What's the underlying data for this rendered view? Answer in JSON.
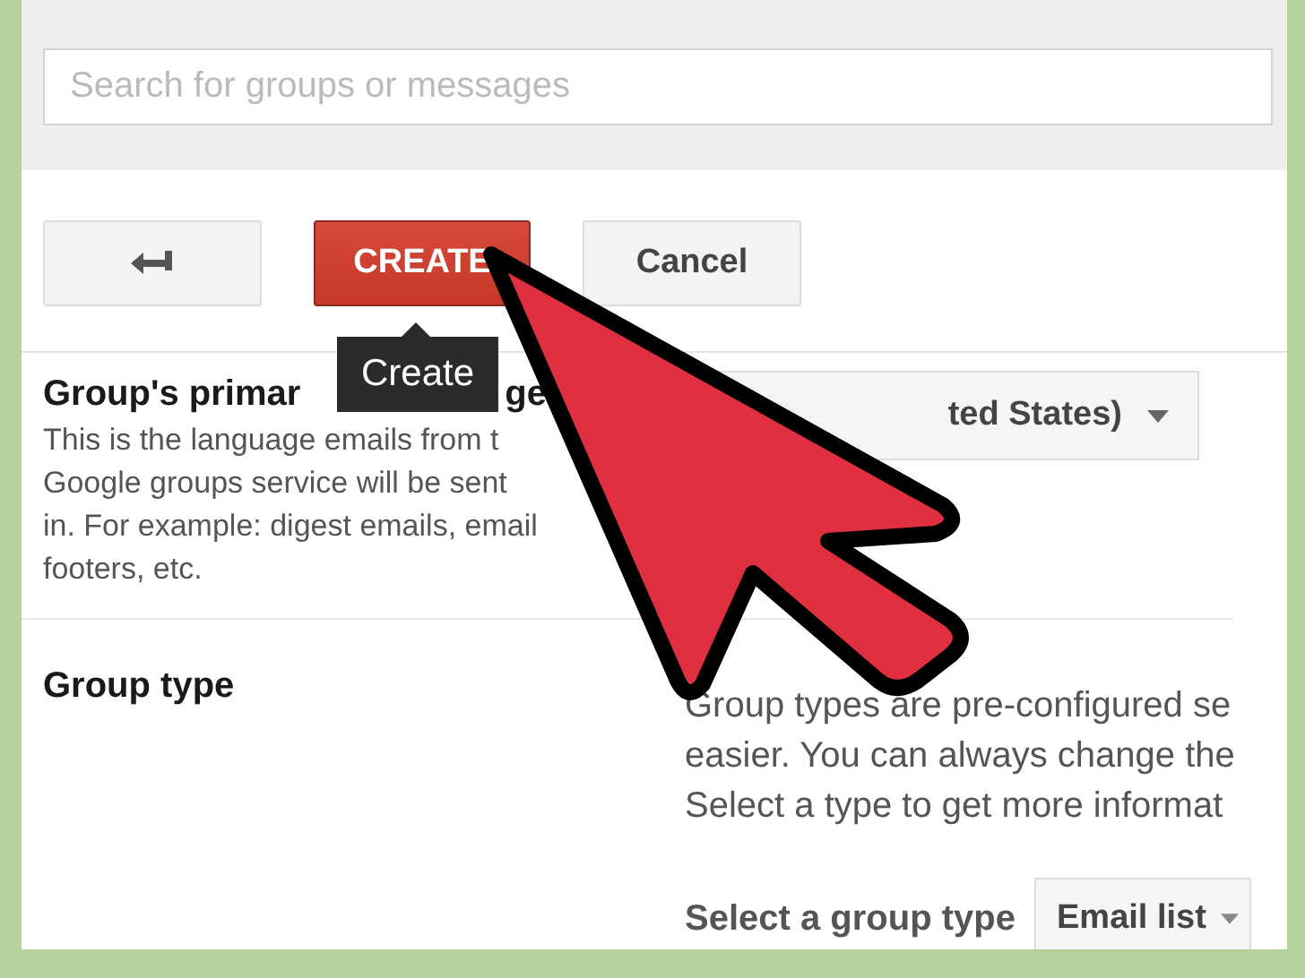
{
  "search": {
    "placeholder": "Search for groups or messages"
  },
  "buttons": [
    {
      "kind": "back"
    },
    {
      "kind": "primary",
      "label": "CREATE"
    },
    {
      "kind": "default",
      "label": "Cancel"
    }
  ],
  "tooltip": "Create",
  "language": {
    "heading_parts": [
      "Group's primar",
      "ge"
    ],
    "description": [
      "This is the language emails from t",
      "Google groups service will be sent",
      "in. For example: digest emails, email",
      "footers, etc."
    ],
    "dropdown": "ted States)"
  },
  "group_type": {
    "heading": "Group type",
    "description": [
      "Group types are pre-configured se",
      "easier. You can always change the",
      "Select a type to get more informat"
    ],
    "select_label": "Select a group type",
    "dropdown": "Email list"
  }
}
